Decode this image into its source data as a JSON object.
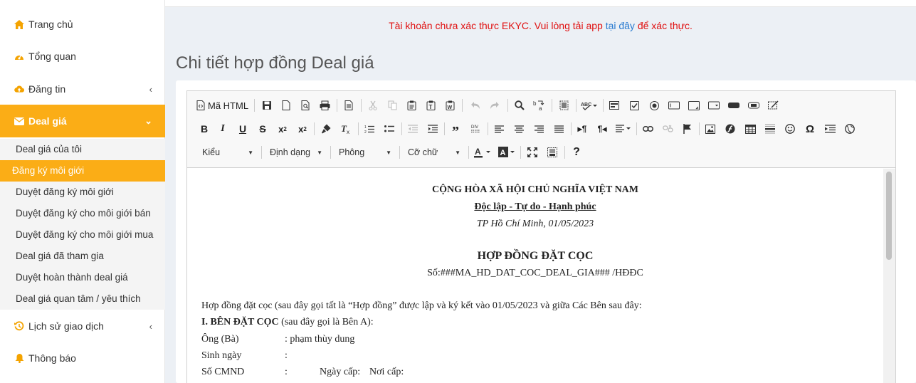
{
  "sidebar": {
    "items": [
      {
        "label": "Trang chủ",
        "icon": "home-icon"
      },
      {
        "label": "Tổng quan",
        "icon": "dashboard-icon"
      },
      {
        "label": "Đăng tin",
        "icon": "cloud-upload-icon"
      },
      {
        "label": "Deal giá",
        "icon": "envelope-icon"
      },
      {
        "label": "Lịch sử giao dịch",
        "icon": "history-icon"
      },
      {
        "label": "Thông báo",
        "icon": "bell-icon"
      }
    ],
    "submenu": [
      "Deal giá của tôi",
      "Đăng ký môi giới",
      "Duyệt đăng ký môi giới",
      "Duyệt đăng ký cho môi giới bán",
      "Duyệt đăng ký cho môi giới mua",
      "Deal giá đã tham gia",
      "Duyệt hoàn thành deal giá",
      "Deal giá quan tâm / yêu thích"
    ],
    "accent_color": "#fbad16"
  },
  "notice": {
    "text_before": "Tài khoản chưa xác thực EKYC. Vui lòng tải app ",
    "link": "tại đây",
    "text_after": " để xác thực."
  },
  "page_title": "Chi tiết hợp đồng Deal giá",
  "editor": {
    "toolbar": {
      "source_label": "Mã HTML",
      "style_combo": "Kiểu",
      "format_combo": "Định dạng",
      "font_combo": "Phông",
      "size_combo": "Cỡ chữ"
    },
    "document": {
      "nation": "CỘNG HÒA XÃ HỘI CHỦ NGHĨA VIỆT NAM",
      "motto": "Độc lập - Tự do - Hạnh phúc",
      "place_date": "TP Hồ Chí Minh, 01/05/2023",
      "title": "HỢP ĐỒNG ĐẶT CỌC",
      "number": "Số:###MA_HD_DAT_COC_DEAL_GIA### /HĐĐC",
      "intro": "Hợp đồng đặt cọc (sau đây gọi tất là “Hợp đồng” được lập và ký kết vào 01/05/2023 và giữa Các Bên sau đây:",
      "party_a_heading": "I. BÊN ĐẶT CỌC",
      "party_a_note": " (sau đây gọi là Bên A):",
      "fields": {
        "name_label": "Ông (Bà)",
        "name_value": ": phạm thùy dung",
        "dob_label": "Sinh ngày",
        "dob_value": ":",
        "id_label": "Số CMND",
        "id_value": ":",
        "issue_date_label": "Ngày cấp:",
        "issue_place_label": "Nơi cấp:"
      }
    }
  }
}
